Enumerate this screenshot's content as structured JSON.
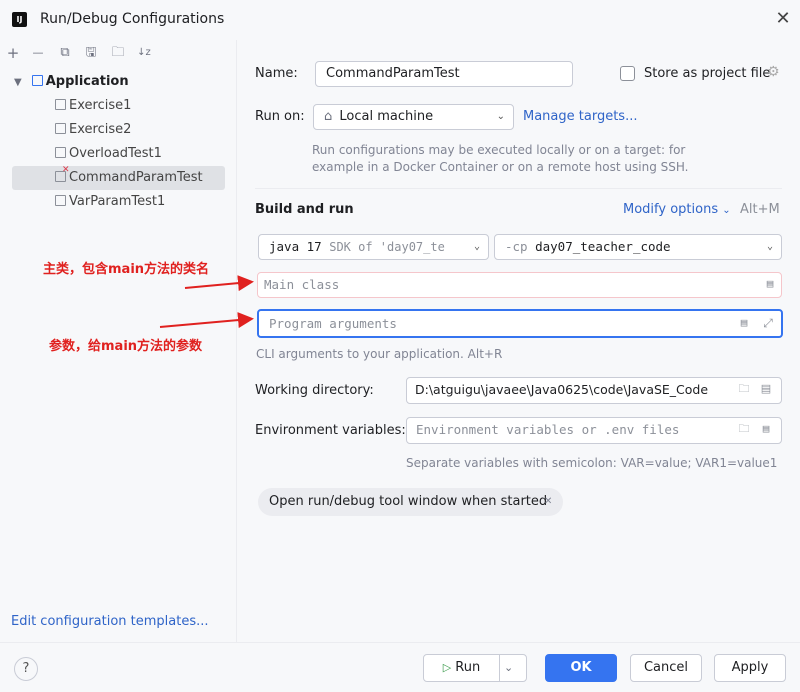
{
  "window": {
    "logo": "IJ",
    "title": "Run/Debug Configurations",
    "close_label": "✕"
  },
  "toolbar": {
    "add": "+",
    "remove": "—",
    "copy": "⧉",
    "save": "🖫",
    "folder": "🗀",
    "sort": "↓z"
  },
  "tree": {
    "group": "Application",
    "items": [
      "Exercise1",
      "Exercise2",
      "OverloadTest1",
      "CommandParamTest",
      "VarParamTest1"
    ]
  },
  "edit_templates": "Edit configuration templates...",
  "form": {
    "name_label": "Name:",
    "name_value": "CommandParamTest",
    "store_label": "Store as project file",
    "run_on_label": "Run on:",
    "run_on_value": "Local machine",
    "manage_targets": "Manage targets...",
    "run_on_hint_1": "Run configurations may be executed locally or on a target: for",
    "run_on_hint_2": "example in a Docker Container or on a remote host using SSH.",
    "build_run": "Build and run",
    "modify_options": "Modify options",
    "modify_shortcut": "Alt+M",
    "jdk_java": "java 17",
    "jdk_sdk": "SDK of 'day07_te",
    "cp_prefix": "-cp",
    "cp_value": "day07_teacher_code",
    "main_class_ph": "Main class",
    "program_args_ph": "Program arguments",
    "cli_hint": "CLI arguments to your application. Alt+R",
    "workdir_label": "Working directory:",
    "workdir_value": "D:\\atguigu\\javaee\\Java0625\\code\\JavaSE_Code",
    "env_label": "Environment variables:",
    "env_ph": "Environment variables or .env files",
    "env_hint": "Separate variables with semicolon: VAR=value; VAR1=value1",
    "chip": "Open run/debug tool window when started"
  },
  "annotations": {
    "main_class": "主类，包含main方法的类名",
    "args": "参数，给main方法的参数"
  },
  "buttons": {
    "help": "?",
    "run": "Run",
    "ok": "OK",
    "cancel": "Cancel",
    "apply": "Apply"
  },
  "colors": {
    "accent": "#3574f0",
    "link": "#2f64c8",
    "annotation": "#e0211f",
    "error_border": "#f5c6cb"
  }
}
